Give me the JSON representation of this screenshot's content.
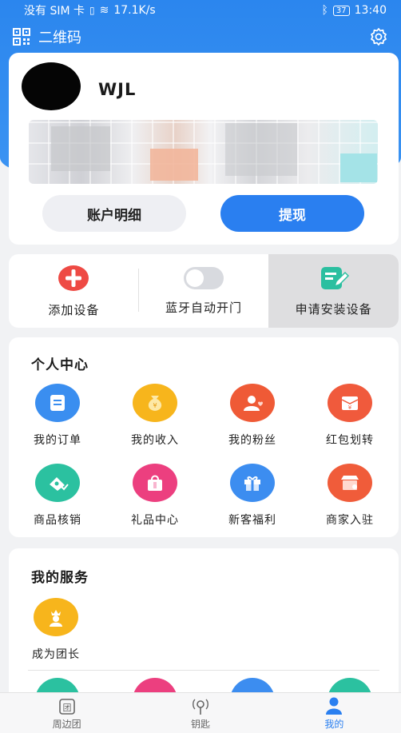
{
  "status_bar": {
    "carrier": "没有 SIM 卡",
    "speed": "17.1K/s",
    "battery": "37",
    "time": "13:40"
  },
  "header": {
    "qr_label": "二维码"
  },
  "profile": {
    "username": "WJL",
    "detail_button": "账户明细",
    "withdraw_button": "提现"
  },
  "quick_actions": {
    "add_device": "添加设备",
    "bluetooth_auto_open": "蓝牙自动开门",
    "apply_install": "申请安装设备"
  },
  "personal_center": {
    "title": "个人中心",
    "items": [
      {
        "label": "我的订单",
        "icon": "order-icon",
        "color": "#3a8ef0"
      },
      {
        "label": "我的收入",
        "icon": "money-bag-icon",
        "color": "#f7b51c"
      },
      {
        "label": "我的粉丝",
        "icon": "fans-icon",
        "color": "#ef5a36"
      },
      {
        "label": "红包划转",
        "icon": "red-packet-icon",
        "color": "#f05a3c"
      },
      {
        "label": "商品核销",
        "icon": "ticket-check-icon",
        "color": "#2bc1a0"
      },
      {
        "label": "礼品中心",
        "icon": "gift-bag-icon",
        "color": "#ec3f7f"
      },
      {
        "label": "新客福利",
        "icon": "gift-box-icon",
        "color": "#3c8df0"
      },
      {
        "label": "商家入驻",
        "icon": "shop-icon",
        "color": "#f05c3a"
      }
    ]
  },
  "services": {
    "title": "我的服务",
    "items": [
      {
        "label": "成为团长",
        "icon": "leader-icon",
        "color": "#f7b51c"
      }
    ]
  },
  "tabbar": {
    "tabs": [
      {
        "label": "周边团",
        "icon": "group-icon"
      },
      {
        "label": "钥匙",
        "icon": "key-signal-icon"
      },
      {
        "label": "我的",
        "icon": "user-icon",
        "active": true
      }
    ]
  }
}
